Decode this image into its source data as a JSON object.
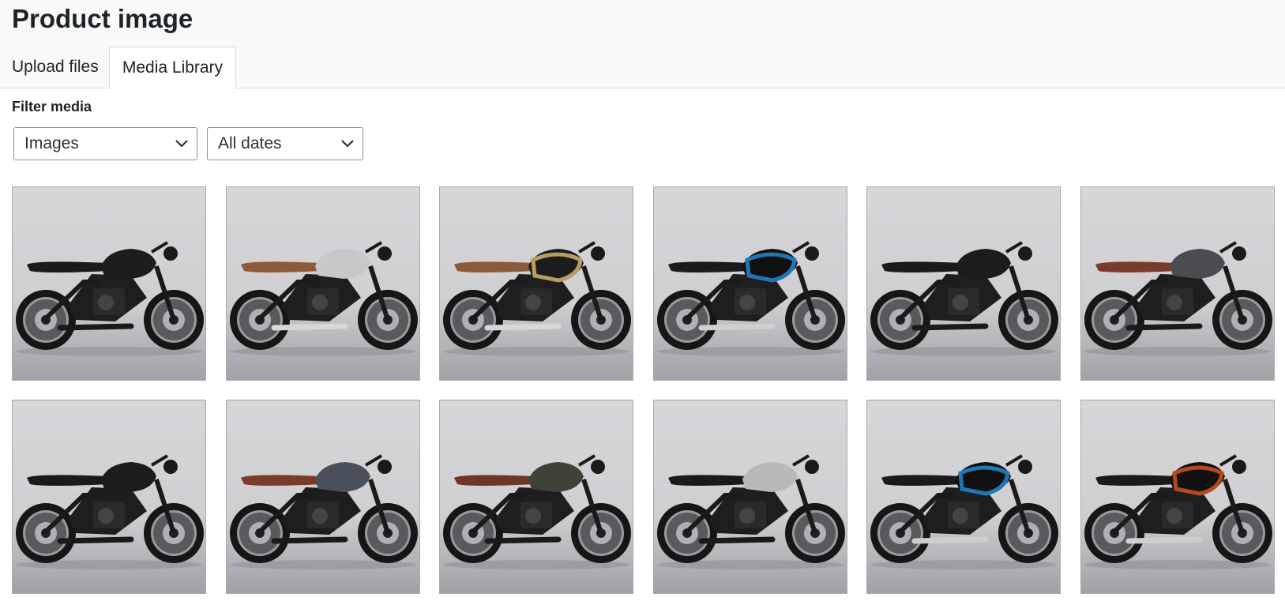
{
  "header": {
    "title": "Product image",
    "tabs": [
      {
        "label": "Upload files",
        "active": false
      },
      {
        "label": "Media Library",
        "active": true
      }
    ]
  },
  "filters": {
    "label": "Filter media",
    "type_select": {
      "value": "Images"
    },
    "date_select": {
      "value": "All dates"
    }
  },
  "media": {
    "items": [
      {
        "tank": "#1c1c1c",
        "seat": "#1a1a1a",
        "stripe": null,
        "exhaust": "#1a1a1a"
      },
      {
        "tank": "#c8c8ca",
        "seat": "#8a5a3a",
        "stripe": null,
        "exhaust": "#d7d7d7"
      },
      {
        "tank": "#1c1c1c",
        "seat": "#8a5a3a",
        "stripe": "#b79d63",
        "exhaust": "#d7d7d7"
      },
      {
        "tank": "#111111",
        "seat": "#1a1a1a",
        "stripe": "#1f78b4",
        "exhaust": "#cfcfcf"
      },
      {
        "tank": "#1c1c1c",
        "seat": "#1a1a1a",
        "stripe": null,
        "exhaust": "#1a1a1a"
      },
      {
        "tank": "#4a4c52",
        "seat": "#7a3b2a",
        "stripe": null,
        "exhaust": "#1a1a1a"
      },
      {
        "tank": "#1c1c1c",
        "seat": "#1a1a1a",
        "stripe": null,
        "exhaust": "#1a1a1a"
      },
      {
        "tank": "#4a4f5c",
        "seat": "#7a3b2a",
        "stripe": null,
        "exhaust": "#1a1a1a"
      },
      {
        "tank": "#3e4238",
        "seat": "#6e3626",
        "stripe": null,
        "exhaust": "#1a1a1a"
      },
      {
        "tank": "#b9b9bc",
        "seat": "#1a1a1a",
        "stripe": null,
        "exhaust": "#1a1a1a"
      },
      {
        "tank": "#111111",
        "seat": "#1a1a1a",
        "stripe": "#1f78b4",
        "exhaust": "#cfcfcf"
      },
      {
        "tank": "#111111",
        "seat": "#1a1a1a",
        "stripe": "#b5481f",
        "exhaust": "#cfcfcf"
      }
    ]
  }
}
